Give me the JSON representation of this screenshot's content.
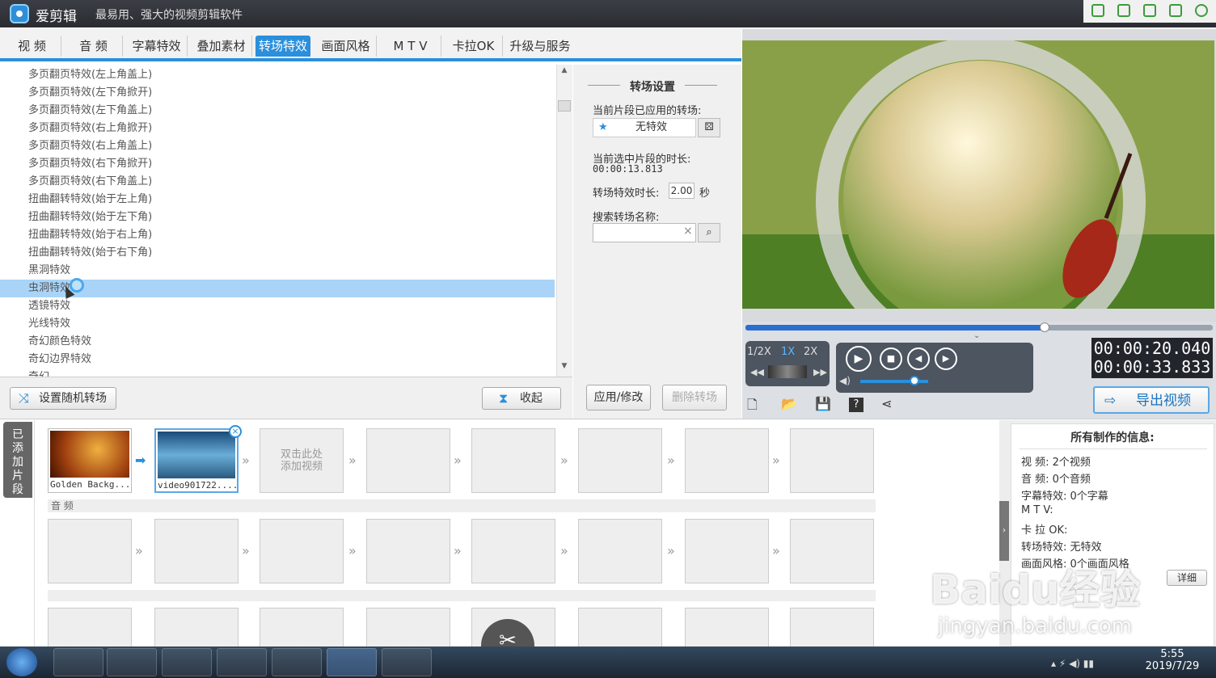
{
  "app": {
    "name": "爱剪辑",
    "slogan": "最易用、强大的视频剪辑软件"
  },
  "tabs": [
    {
      "label": "视  频"
    },
    {
      "label": "音  频"
    },
    {
      "label": "字幕特效"
    },
    {
      "label": "叠加素材"
    },
    {
      "label": "转场特效",
      "active": true
    },
    {
      "label": "画面风格"
    },
    {
      "label": "M T V"
    },
    {
      "label": "卡拉OK"
    },
    {
      "label": "升级与服务"
    }
  ],
  "transition_list": [
    "多页翻页特效(左上角盖上)",
    "多页翻页特效(左下角掀开)",
    "多页翻页特效(左下角盖上)",
    "多页翻页特效(右上角掀开)",
    "多页翻页特效(右上角盖上)",
    "多页翻页特效(右下角掀开)",
    "多页翻页特效(右下角盖上)",
    "扭曲翻转特效(始于左上角)",
    "扭曲翻转特效(始于左下角)",
    "扭曲翻转特效(始于右上角)",
    "扭曲翻转特效(始于右下角)",
    "黑洞特效",
    "虫洞特效",
    "透镜特效",
    "光线特效",
    "奇幻颜色特效",
    "奇幻边界特效",
    "奇幻…"
  ],
  "selected_index": 12,
  "list_footer": {
    "random_btn": "设置随机转场",
    "collapse_btn": "收起"
  },
  "settings": {
    "header": "转场设置",
    "applied_label": "当前片段已应用的转场:",
    "applied_value": "无特效",
    "duration_label": "当前选中片段的时长:",
    "duration_value": "00:00:13.813",
    "effect_len_label": "转场特效时长:",
    "effect_len_value": "2.00",
    "effect_len_unit": "秒",
    "search_label": "搜索转场名称:",
    "search_value": "",
    "apply_btn": "应用/修改",
    "delete_btn": "删除转场"
  },
  "player": {
    "speeds": [
      "1/2X",
      "1X",
      "2X"
    ],
    "active_speed": "1X",
    "progress": 0.64,
    "volume": 0.8,
    "time_current": "00:00:20.040",
    "time_total": "00:00:33.833",
    "export_btn": "导出视频"
  },
  "timeline": {
    "added_tab": "已添加片段",
    "clips": [
      "Golden Backg...",
      "video901722...."
    ],
    "add_hint": "双击此处添加视频",
    "audio_label": "音 频"
  },
  "info": {
    "title": "所有制作的信息:",
    "rows": [
      {
        "key": "视      频:",
        "val": "2个视频"
      },
      {
        "key": "音      频:",
        "val": "0个音频"
      },
      {
        "key": "字幕特效:",
        "val": "0个字幕"
      },
      {
        "key": "M   T   V:",
        "val": ""
      },
      {
        "key": "卡 拉 OK:",
        "val": ""
      },
      {
        "key": "转场特效:",
        "val": "无特效"
      },
      {
        "key": "画面风格:",
        "val": "0个画面风格"
      }
    ],
    "detail_btn": "详细"
  },
  "taskbar": {
    "time": "5:55",
    "date": "2019/7/29"
  },
  "watermark": {
    "main": "Baidu经验",
    "sub": "jingyan.baidu.com"
  },
  "colors": {
    "accent": "#2a8fdc",
    "selected_row": "#a9d4f8",
    "title_bg": "#2a2c31"
  }
}
